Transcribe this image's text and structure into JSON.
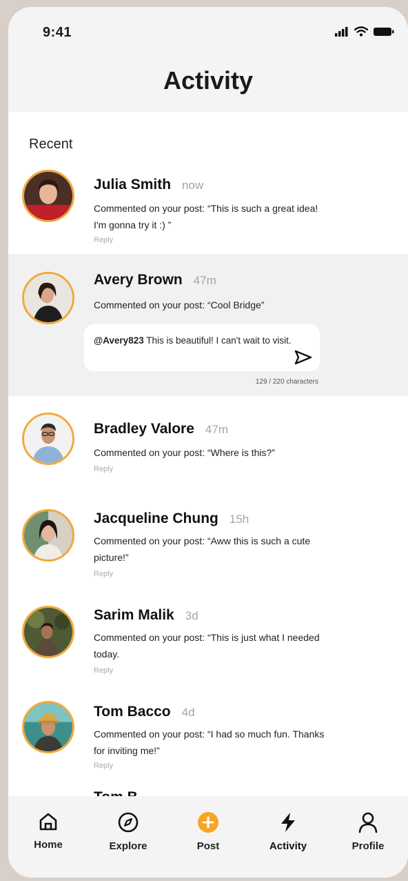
{
  "status_bar": {
    "time": "9:41"
  },
  "header": {
    "title": "Activity"
  },
  "section_label": "Recent",
  "activity": [
    {
      "name": "Julia Smith",
      "time": "now",
      "comment": "Commented on your post: “This is such a great idea! I'm gonna try it :) ”",
      "reply_label": "Reply"
    },
    {
      "name": "Avery Brown",
      "time": "47m",
      "comment": "Commented on your post: “Cool Bridge”",
      "reply_input": {
        "mention": "@Avery823",
        "text": " This is beautiful! I can't wait to visit.",
        "char_count": "129 / 220 characters"
      }
    },
    {
      "name": "Bradley Valore",
      "time": "47m",
      "comment": "Commented on your post: “Where is this?”",
      "reply_label": "Reply"
    },
    {
      "name": "Jacqueline Chung",
      "time": "15h",
      "comment": "Commented on your post: “Aww this is such a cute picture!”",
      "reply_label": "Reply"
    },
    {
      "name": "Sarim Malik",
      "time": "3d",
      "comment": "Commented on your post: “This is just what I needed today.",
      "reply_label": "Reply"
    },
    {
      "name": "Tom Bacco",
      "time": "4d",
      "comment": "Commented on your post: “I had so much fun. Thanks for inviting me!”",
      "reply_label": "Reply"
    }
  ],
  "peek_name": "Tom B",
  "tabs": [
    {
      "label": "Home",
      "icon": "home-icon"
    },
    {
      "label": "Explore",
      "icon": "compass-icon"
    },
    {
      "label": "Post",
      "icon": "plus-circle-icon"
    },
    {
      "label": "Activity",
      "icon": "lightning-icon",
      "active": true
    },
    {
      "label": "Profile",
      "icon": "user-icon"
    }
  ],
  "colors": {
    "accent": "#f2a93b",
    "post_button": "#f5a623",
    "highlight_row": "#f1f1f1",
    "header_bg": "#f4f4f4"
  }
}
